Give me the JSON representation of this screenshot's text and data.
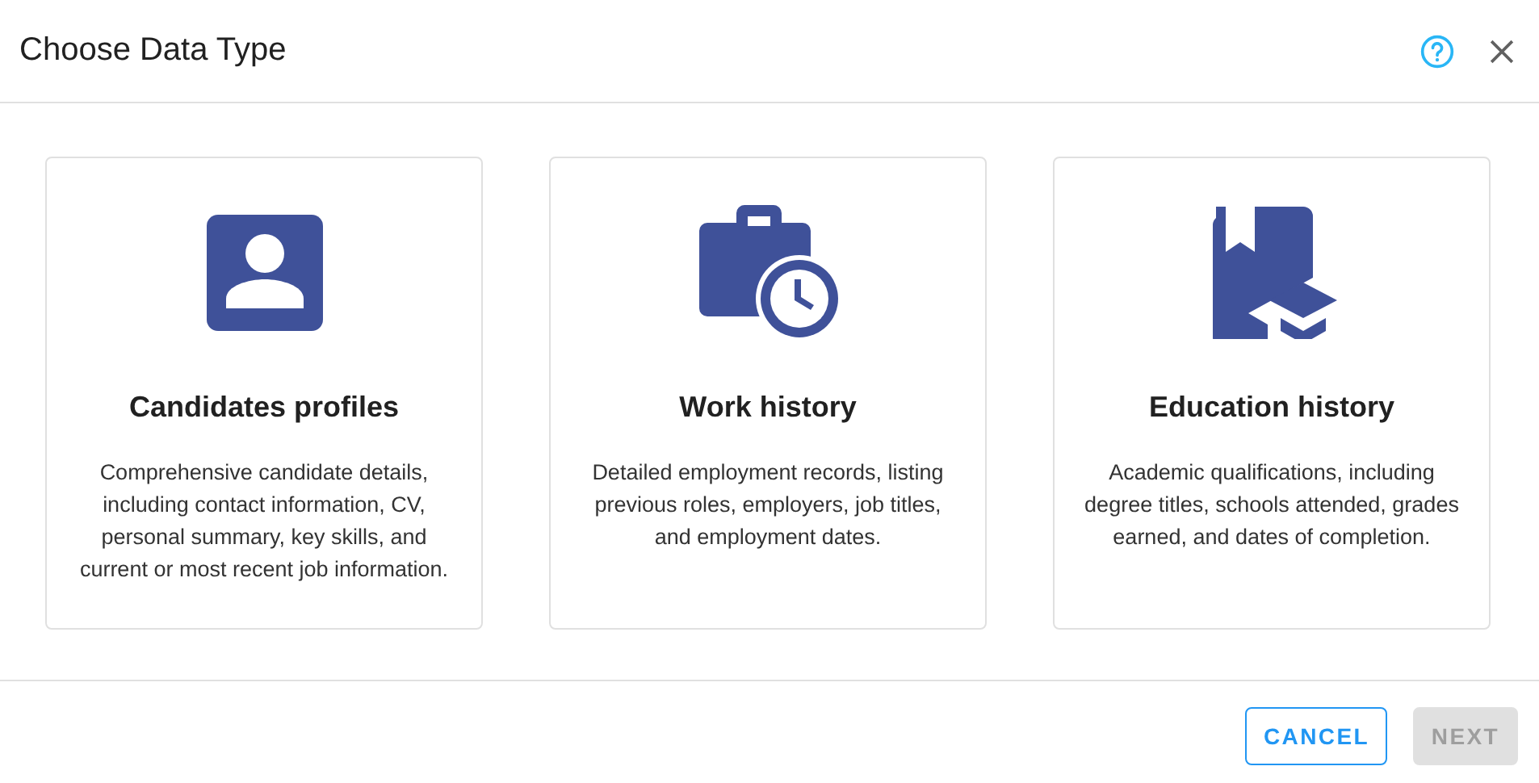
{
  "dialog": {
    "title": "Choose Data Type"
  },
  "cards": [
    {
      "kind": "profile",
      "title": "Candidates profiles",
      "description": "Comprehensive candidate details, including contact information, CV, personal summary, key skills, and current or most recent job information."
    },
    {
      "kind": "work",
      "title": "Work history",
      "description": "Detailed employment records, listing previous roles, employers, job titles, and employment dates."
    },
    {
      "kind": "education",
      "title": "Education history",
      "description": "Academic qualifications, including degree titles, schools attended, grades earned, and dates of completion."
    }
  ],
  "buttons": [
    {
      "label": "CANCEL",
      "disabled": false
    },
    {
      "label": "NEXT",
      "disabled": true
    }
  ]
}
